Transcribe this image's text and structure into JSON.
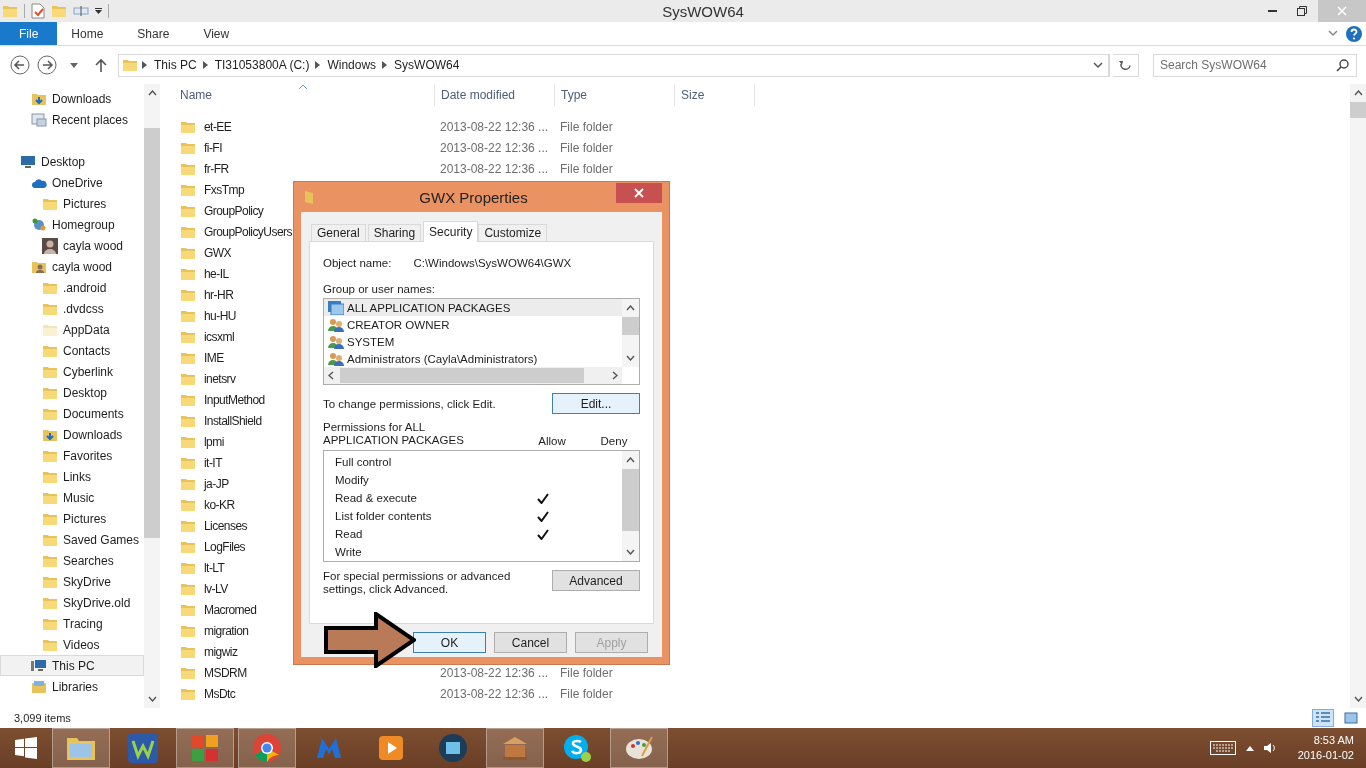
{
  "window": {
    "title": "SysWOW64"
  },
  "ribbon_tabs": [
    {
      "label": "File",
      "kind": "file"
    },
    {
      "label": "Home",
      "kind": "tab"
    },
    {
      "label": "Share",
      "kind": "tab"
    },
    {
      "label": "View",
      "kind": "tab"
    }
  ],
  "breadcrumb": [
    "This PC",
    "TI31053800A (C:)",
    "Windows",
    "SysWOW64"
  ],
  "search": {
    "placeholder": "Search SysWOW64"
  },
  "sidebar": {
    "top_items": [
      {
        "label": "Downloads",
        "kind": "download",
        "selected": false
      },
      {
        "label": "Recent places",
        "kind": "recent",
        "selected": false
      }
    ],
    "items": [
      {
        "label": "Desktop",
        "kind": "monitor",
        "selected": false,
        "children": [
          {
            "label": "OneDrive",
            "kind": "cloud",
            "selected": false,
            "children": [
              {
                "label": "Pictures",
                "kind": "folder",
                "selected": false
              }
            ]
          },
          {
            "label": "Homegroup",
            "kind": "network",
            "selected": false,
            "children": [
              {
                "label": "cayla wood",
                "kind": "avatar",
                "selected": false
              }
            ]
          },
          {
            "label": "cayla wood",
            "kind": "user",
            "selected": false,
            "children": [
              {
                "label": ".android",
                "kind": "folder",
                "selected": false
              },
              {
                "label": ".dvdcss",
                "kind": "folder",
                "selected": false
              },
              {
                "label": "AppData",
                "kind": "hidden",
                "selected": false
              },
              {
                "label": "Contacts",
                "kind": "folder",
                "selected": false
              },
              {
                "label": "Cyberlink",
                "kind": "folder",
                "selected": false
              },
              {
                "label": "Desktop",
                "kind": "folder",
                "selected": false
              },
              {
                "label": "Documents",
                "kind": "folder",
                "selected": false
              },
              {
                "label": "Downloads",
                "kind": "download",
                "selected": false
              },
              {
                "label": "Favorites",
                "kind": "folder",
                "selected": false
              },
              {
                "label": "Links",
                "kind": "folder",
                "selected": false
              },
              {
                "label": "Music",
                "kind": "folder",
                "selected": false
              },
              {
                "label": "Pictures",
                "kind": "folder",
                "selected": false
              },
              {
                "label": "Saved Games",
                "kind": "folder",
                "selected": false
              },
              {
                "label": "Searches",
                "kind": "folder",
                "selected": false
              },
              {
                "label": "SkyDrive",
                "kind": "folder",
                "selected": false
              },
              {
                "label": "SkyDrive.old",
                "kind": "folder",
                "selected": false
              },
              {
                "label": "Tracing",
                "kind": "folder",
                "selected": false
              },
              {
                "label": "Videos",
                "kind": "folder",
                "selected": false
              }
            ]
          },
          {
            "label": "This PC",
            "kind": "computer",
            "selected": true
          },
          {
            "label": "Libraries",
            "kind": "library",
            "selected": false
          }
        ]
      }
    ]
  },
  "table": {
    "columns": [
      "Name",
      "Date modified",
      "Type",
      "Size"
    ],
    "rows": [
      {
        "name": "et-EE",
        "date": "2013-08-22 12:36 ...",
        "type": "File folder"
      },
      {
        "name": "fi-FI",
        "date": "2013-08-22 12:36 ...",
        "type": "File folder"
      },
      {
        "name": "fr-FR",
        "date": "2013-08-22 12:36 ...",
        "type": "File folder"
      },
      {
        "name": "FxsTmp"
      },
      {
        "name": "GroupPolicy"
      },
      {
        "name": "GroupPolicyUsers"
      },
      {
        "name": "GWX"
      },
      {
        "name": "he-IL"
      },
      {
        "name": "hr-HR"
      },
      {
        "name": "hu-HU"
      },
      {
        "name": "icsxml"
      },
      {
        "name": "IME"
      },
      {
        "name": "inetsrv"
      },
      {
        "name": "InputMethod"
      },
      {
        "name": "InstallShield"
      },
      {
        "name": "lpmi"
      },
      {
        "name": "it-IT"
      },
      {
        "name": "ja-JP"
      },
      {
        "name": "ko-KR"
      },
      {
        "name": "Licenses"
      },
      {
        "name": "LogFiles"
      },
      {
        "name": "lt-LT"
      },
      {
        "name": "lv-LV"
      },
      {
        "name": "Macromed"
      },
      {
        "name": "migration"
      },
      {
        "name": "migwiz"
      },
      {
        "name": "MSDRM",
        "date": "2013-08-22 12:36 ...",
        "type": "File folder"
      },
      {
        "name": "MsDtc",
        "date": "2013-08-22 12:36 ...",
        "type": "File folder"
      }
    ]
  },
  "status_bar": {
    "item_count": "3,099 items",
    "views": [
      {
        "kind": "details",
        "selected": true
      },
      {
        "kind": "icons",
        "selected": false
      }
    ]
  },
  "dialog": {
    "title": "GWX Properties",
    "tabs": [
      {
        "label": "General",
        "selected": false
      },
      {
        "label": "Sharing",
        "selected": false
      },
      {
        "label": "Security",
        "selected": true
      },
      {
        "label": "Customize",
        "selected": false
      }
    ],
    "object_label": "Object name:",
    "object_value": "C:\\Windows\\SysWOW64\\GWX",
    "group_label": "Group or user names:",
    "groups": [
      {
        "name": "ALL APPLICATION PACKAGES",
        "kind": "package",
        "selected": true
      },
      {
        "name": "CREATOR OWNER",
        "kind": "users",
        "selected": false
      },
      {
        "name": "SYSTEM",
        "kind": "users",
        "selected": false
      },
      {
        "name": "Administrators (Cayla\\Administrators)",
        "kind": "users",
        "selected": false
      }
    ],
    "edit_hint": "To change permissions, click Edit.",
    "edit_button": "Edit...",
    "permissions_label": "Permissions for ALL\nAPPLICATION PACKAGES",
    "allow_label": "Allow",
    "deny_label": "Deny",
    "permissions": [
      {
        "name": "Full control",
        "allow": false,
        "deny": false
      },
      {
        "name": "Modify",
        "allow": false,
        "deny": false
      },
      {
        "name": "Read & execute",
        "allow": true,
        "deny": false
      },
      {
        "name": "List folder contents",
        "allow": true,
        "deny": false
      },
      {
        "name": "Read",
        "allow": true,
        "deny": false
      },
      {
        "name": "Write",
        "allow": false,
        "deny": false
      }
    ],
    "advanced_hint": "For special permissions or advanced settings, click Advanced.",
    "advanced_button": "Advanced",
    "buttons": [
      {
        "label": "OK",
        "disabled": false
      },
      {
        "label": "Cancel",
        "disabled": false
      },
      {
        "label": "Apply",
        "disabled": true
      }
    ]
  },
  "taskbar": {
    "apps": [
      {
        "kind": "explorer",
        "active": true
      },
      {
        "kind": "wordweb",
        "active": false
      },
      {
        "kind": "avast",
        "active": true
      },
      {
        "kind": "chrome",
        "active": true
      },
      {
        "kind": "malware",
        "active": false
      },
      {
        "kind": "player",
        "active": false
      },
      {
        "kind": "video",
        "active": false
      },
      {
        "kind": "museum",
        "active": true
      },
      {
        "kind": "skype",
        "active": false
      },
      {
        "kind": "paint",
        "active": true
      }
    ],
    "time": "8:53 AM",
    "date": "2016-01-02"
  }
}
